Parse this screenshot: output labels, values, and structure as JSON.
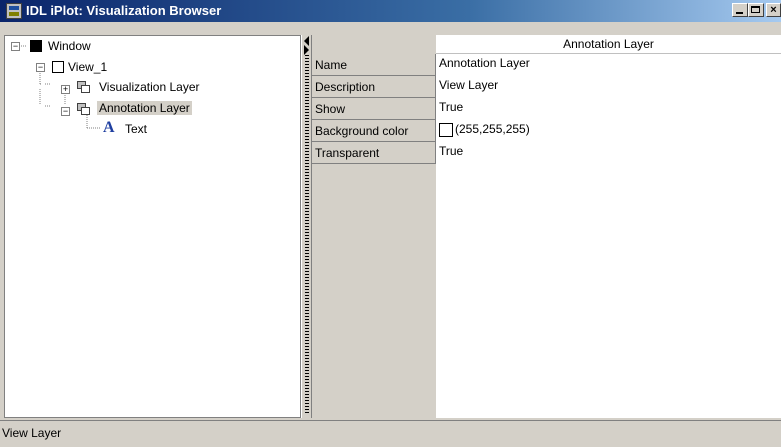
{
  "window": {
    "title": "IDL iPlot: Visualization Browser",
    "buttons": {
      "minimize": "",
      "maximize": "",
      "close": "×"
    }
  },
  "tree": {
    "nodes": [
      {
        "label": "Window",
        "expander": "−",
        "icon": "window-icon"
      },
      {
        "label": "View_1",
        "expander": "−",
        "icon": "view-icon"
      },
      {
        "label": "Visualization Layer",
        "expander": "+",
        "icon": "layer-icon"
      },
      {
        "label": "Annotation Layer",
        "expander": "−",
        "icon": "layer-icon",
        "selected": true
      },
      {
        "label": "Text",
        "icon": "text-icon",
        "glyph": "A"
      }
    ]
  },
  "properties": {
    "header": "Annotation Layer",
    "rows": [
      {
        "name": "Name",
        "value": "Annotation Layer"
      },
      {
        "name": "Description",
        "value": "View Layer"
      },
      {
        "name": "Show",
        "value": "True"
      },
      {
        "name": "Background color",
        "value": "(255,255,255)",
        "swatch": "#ffffff"
      },
      {
        "name": "Transparent",
        "value": "True"
      }
    ]
  },
  "status": {
    "text": "View Layer"
  },
  "colors": {
    "title_gradient_start": "#0a246a",
    "title_gradient_end": "#a6caf0",
    "chrome": "#d4d0c8",
    "text_icon": "#1f3fa0"
  }
}
